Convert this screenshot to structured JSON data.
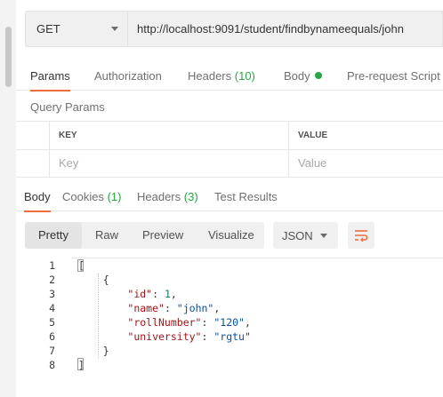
{
  "request": {
    "method": "GET",
    "url": "http://localhost:9091/student/findbynameequals/john"
  },
  "request_tabs": {
    "params": "Params",
    "authorization": "Authorization",
    "headers": "Headers",
    "headers_count": "(10)",
    "body": "Body",
    "prerequest": "Pre-request Script"
  },
  "query_params": {
    "title": "Query Params",
    "key_header": "KEY",
    "value_header": "VALUE",
    "key_placeholder": "Key",
    "value_placeholder": "Value"
  },
  "response_tabs": {
    "body": "Body",
    "cookies": "Cookies",
    "cookies_count": "(1)",
    "headers": "Headers",
    "headers_count": "(3)",
    "test_results": "Test Results"
  },
  "view_modes": {
    "pretty": "Pretty",
    "raw": "Raw",
    "preview": "Preview",
    "visualize": "Visualize"
  },
  "format": "JSON",
  "code": {
    "line_numbers": [
      "1",
      "2",
      "3",
      "4",
      "5",
      "6",
      "7",
      "8"
    ],
    "open_bracket": "[",
    "open_brace": "{",
    "close_brace": "}",
    "close_bracket": "]",
    "fields": [
      {
        "key": "\"id\"",
        "value": "1",
        "sep": ","
      },
      {
        "key": "\"name\"",
        "value": "\"john\"",
        "sep": ","
      },
      {
        "key": "\"rollNumber\"",
        "value": "\"120\"",
        "sep": ","
      },
      {
        "key": "\"university\"",
        "value": "\"rgtu\"",
        "sep": ""
      }
    ]
  },
  "colors": {
    "accent": "#f26b3a",
    "count_green": "#27a744",
    "json_key": "#a31515",
    "json_string": "#0451a5",
    "json_number": "#098658"
  },
  "icons": {
    "method_dropdown": "chevron-down-icon",
    "format_dropdown": "chevron-down-icon",
    "wrap": "text-wrap-icon",
    "body_status": "green-dot-icon"
  }
}
